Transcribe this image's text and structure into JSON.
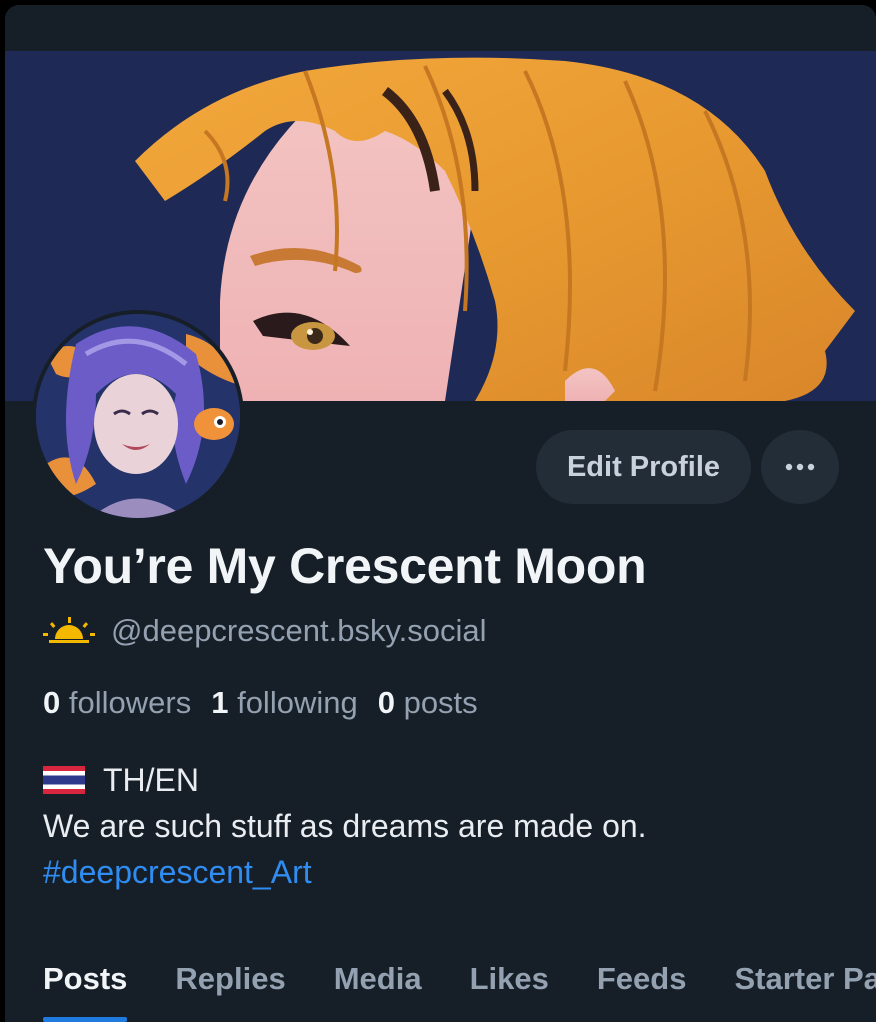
{
  "profile": {
    "display_name": "You’re My Crescent Moon",
    "handle": "@deepcrescent.bsky.social",
    "handle_emoji": "sunrise-icon"
  },
  "stats": {
    "followers_count": "0",
    "followers_label": "followers",
    "following_count": "1",
    "following_label": "following",
    "posts_count": "0",
    "posts_label": "posts"
  },
  "actions": {
    "edit_profile_label": "Edit Profile",
    "more_icon": "ellipsis-icon"
  },
  "bio": {
    "flag_icon": "thailand-flag-icon",
    "line1": "TH/EN",
    "line2": "We are such stuff as dreams are made on.",
    "hashtag": "#deepcrescent_Art"
  },
  "tabs": [
    {
      "label": "Posts",
      "active": true
    },
    {
      "label": "Replies",
      "active": false
    },
    {
      "label": "Media",
      "active": false
    },
    {
      "label": "Likes",
      "active": false
    },
    {
      "label": "Feeds",
      "active": false
    },
    {
      "label": "Starter Packs",
      "active": false
    }
  ],
  "colors": {
    "background": "#161e27",
    "text_primary": "#f2f5f8",
    "text_secondary": "#93a1b1",
    "link": "#2f8cf0",
    "tab_indicator": "#1f7be0",
    "button_bg": "#232d38"
  }
}
